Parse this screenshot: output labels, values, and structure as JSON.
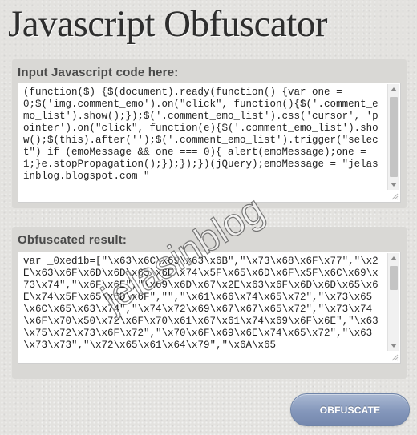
{
  "page": {
    "title": "Javascript Obfuscator"
  },
  "input_panel": {
    "label": "Input Javascript code here:",
    "code": "(function($) {$(document).ready(function() {var one = 0;$('img.comment_emo').on(\"click\", function(){$('.comment_emo_list').show();});$('.comment_emo_list').css('cursor', 'pointer').on(\"click\", function(e){$('.comment_emo_list').show();$(this).after('');$('.comment_emo_list').trigger(\"select\") if (emoMessage && one === 0){ alert(emoMessage);one = 1;}e.stopPropagation();});});})(jQuery);emoMessage = \"jelasinblog.blogspot.com \""
  },
  "output_panel": {
    "label": "Obfuscated result:",
    "code": "var _0xed1b=[\"\\x63\\x6C\\x69\\x63\\x6B\",\"\\x73\\x68\\x6F\\x77\",\"\\x2E\\x63\\x6F\\x6D\\x6D\\x65\\x6E\\x74\\x5F\\x65\\x6D\\x6F\\x5F\\x6C\\x69\\x73\\x74\",\"\\x6F\\x6E\",\"\\x69\\x6D\\x67\\x2E\\x63\\x6F\\x6D\\x6D\\x65\\x6E\\x74\\x5F\\x65\\x6D\\x6F\",\"\",\"\\x61\\x66\\x74\\x65\\x72\",\"\\x73\\x65\\x6C\\x65\\x63\\x74\",\"\\x74\\x72\\x69\\x67\\x67\\x65\\x72\",\"\\x73\\x74\\x6F\\x70\\x50\\x72\\x6F\\x70\\x61\\x67\\x61\\x74\\x69\\x6F\\x6E\",\"\\x63\\x75\\x72\\x73\\x6F\\x72\",\"\\x70\\x6F\\x69\\x6E\\x74\\x65\\x72\",\"\\x63\\x73\\x73\",\"\\x72\\x65\\x61\\x64\\x79\",\"\\x6A\\x65"
  },
  "watermark": {
    "text": "jelasinblog"
  },
  "actions": {
    "obfuscate_label": "OBFUSCATE"
  },
  "colors": {
    "background": "#e3e2df",
    "panel": "#d9d8d5",
    "title": "#2e2e2e",
    "label": "#4a4a4a",
    "button_top": "#aab9d3",
    "button_bottom": "#7487ad"
  },
  "icons": {
    "scrollbar_up": "triangle-up",
    "scrollbar_down": "triangle-down",
    "resize_grip": "diagonal-lines"
  }
}
